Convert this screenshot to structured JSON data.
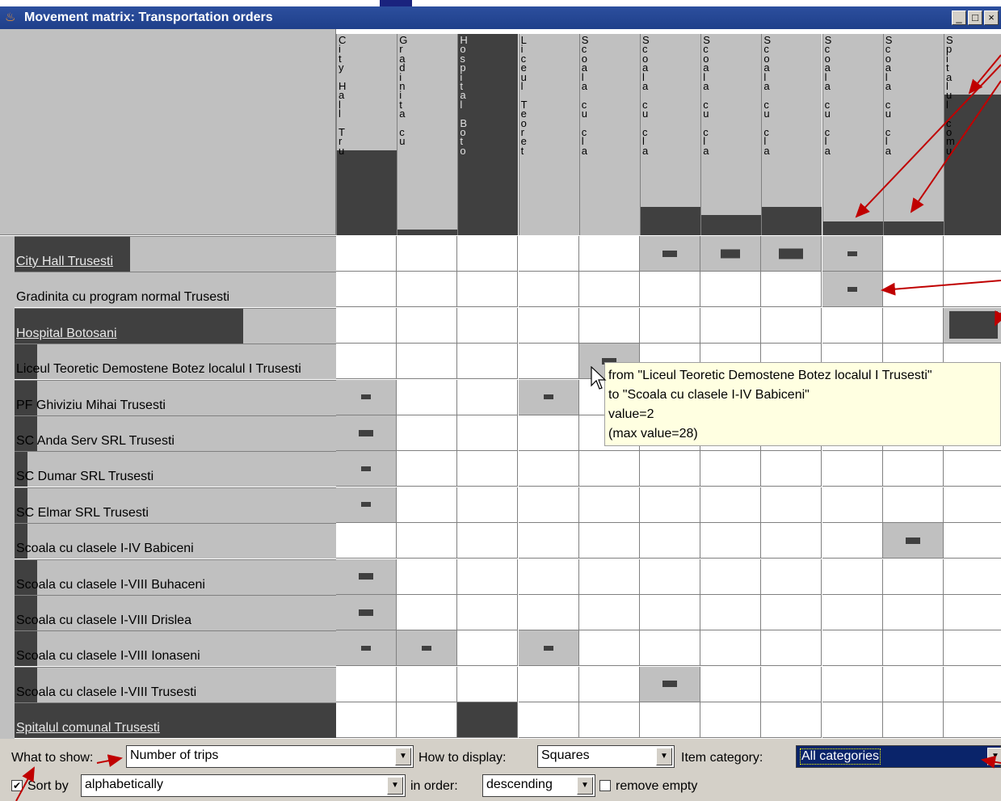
{
  "window": {
    "title": "Movement matrix: Transportation orders",
    "buttons": {
      "minimize": "_",
      "maximize": "□",
      "close": "×"
    }
  },
  "columns": [
    {
      "text": "City Hall Tru",
      "level": 0.42,
      "dark": false
    },
    {
      "text": "Gradinita cu",
      "level": 0.03,
      "dark": false
    },
    {
      "text": "Hospital Boto",
      "level": 1.0,
      "dark": true
    },
    {
      "text": "Liceul Teoret",
      "level": 0.0,
      "dark": false
    },
    {
      "text": "Scoala cu cla",
      "level": 0.0,
      "dark": false
    },
    {
      "text": "Scoala cu cla",
      "level": 0.14,
      "dark": false
    },
    {
      "text": "Scoala cu cla",
      "level": 0.1,
      "dark": false
    },
    {
      "text": "Scoala cu cla",
      "level": 0.14,
      "dark": false
    },
    {
      "text": "Scoala cu cla",
      "level": 0.07,
      "dark": false
    },
    {
      "text": "Scoala cu cla",
      "level": 0.07,
      "dark": false
    },
    {
      "text": "Spitalul comu",
      "level": 0.7,
      "dark": false
    }
  ],
  "rows": [
    {
      "label": "City Hall Trusesti",
      "level": 0.36,
      "dark": true
    },
    {
      "label": "Gradinita cu program normal Trusesti",
      "level": 0.0,
      "dark": false
    },
    {
      "label": "Hospital Botosani",
      "level": 0.71,
      "dark": true
    },
    {
      "label": "Liceul Teoretic Demostene Botez localul I Trusesti",
      "level": 0.07,
      "dark": false
    },
    {
      "label": "PF Ghiviziu Mihai Trusesti",
      "level": 0.07,
      "dark": false
    },
    {
      "label": "SC Anda Serv SRL Trusesti",
      "level": 0.07,
      "dark": false
    },
    {
      "label": "SC Dumar SRL Trusesti",
      "level": 0.04,
      "dark": false
    },
    {
      "label": "SC Elmar SRL Trusesti",
      "level": 0.04,
      "dark": false
    },
    {
      "label": "Scoala cu clasele I-IV Babiceni",
      "level": 0.04,
      "dark": false
    },
    {
      "label": "Scoala cu clasele I-VIII Buhaceni",
      "level": 0.07,
      "dark": false
    },
    {
      "label": "Scoala cu clasele I-VIII Drislea",
      "level": 0.07,
      "dark": false
    },
    {
      "label": "Scoala cu clasele I-VIII Ionaseni",
      "level": 0.07,
      "dark": false
    },
    {
      "label": "Scoala cu clasele I-VIII Trusesti",
      "level": 0.07,
      "dark": false
    },
    {
      "label": "Spitalul comunal Trusesti",
      "level": 1.0,
      "dark": true
    }
  ],
  "cells": [
    {
      "r": 0,
      "c": 5,
      "v": 2
    },
    {
      "r": 0,
      "c": 6,
      "v": 3
    },
    {
      "r": 0,
      "c": 7,
      "v": 4
    },
    {
      "r": 0,
      "c": 8,
      "v": 1
    },
    {
      "r": 1,
      "c": 8,
      "v": 1
    },
    {
      "r": 2,
      "c": 10,
      "v": 28
    },
    {
      "r": 3,
      "c": 4,
      "v": 2
    },
    {
      "r": 4,
      "c": 0,
      "v": 1
    },
    {
      "r": 4,
      "c": 3,
      "v": 1
    },
    {
      "r": 5,
      "c": 0,
      "v": 2
    },
    {
      "r": 6,
      "c": 0,
      "v": 1
    },
    {
      "r": 7,
      "c": 0,
      "v": 1
    },
    {
      "r": 8,
      "c": 9,
      "v": 2
    },
    {
      "r": 9,
      "c": 0,
      "v": 2
    },
    {
      "r": 10,
      "c": 0,
      "v": 2
    },
    {
      "r": 11,
      "c": 0,
      "v": 1
    },
    {
      "r": 11,
      "c": 1,
      "v": 1
    },
    {
      "r": 11,
      "c": 3,
      "v": 1
    },
    {
      "r": 12,
      "c": 5,
      "v": 2
    },
    {
      "r": 13,
      "c": 2,
      "v": 28
    }
  ],
  "tooltip": {
    "line1": "from \"Liceul Teoretic Demostene Botez localul I Trusesti\"",
    "line2": "to \"Scoala cu clasele I-IV Babiceni\"",
    "line3": "value=2",
    "line4": "(max value=28)"
  },
  "controls": {
    "what_label": "What to show:",
    "what_value": "Number of trips",
    "how_label": "How to display:",
    "how_value": "Squares",
    "category_label": "Item category:",
    "category_value": "All categories",
    "sort_label": "Sort by",
    "sort_checked": true,
    "sort_value": "alphabetically",
    "order_label": "in order:",
    "order_value": "descending",
    "remove_empty_label": "remove empty",
    "remove_empty_checked": false
  },
  "colors": {
    "dark": "#404040",
    "light": "#c0c0c0",
    "title": "#1f3f8a",
    "tooltip": "#ffffe1",
    "annotation": "#c00000"
  }
}
